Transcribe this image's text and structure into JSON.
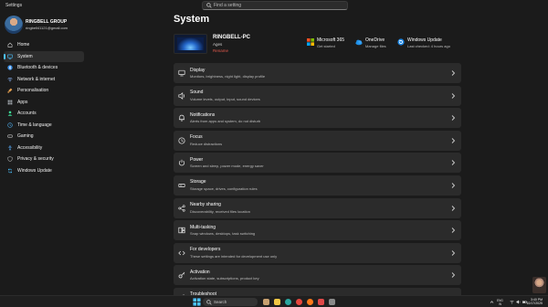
{
  "app": {
    "title": "Settings"
  },
  "search": {
    "placeholder": "Find a setting"
  },
  "profile": {
    "name": "RINGBELL GROUP",
    "email": "ringbell41121@gmail.com"
  },
  "sidebar": {
    "items": [
      {
        "label": "Home",
        "icon": "home-icon",
        "color": "#d9d9d9",
        "active": false
      },
      {
        "label": "System",
        "icon": "monitor-icon",
        "color": "#4cc2ff",
        "active": true
      },
      {
        "label": "Bluetooth & devices",
        "icon": "bluetooth-icon",
        "color": "#3a8ee6",
        "active": false
      },
      {
        "label": "Network & internet",
        "icon": "network-icon",
        "color": "#8ab4f8",
        "active": false
      },
      {
        "label": "Personalisation",
        "icon": "brush-icon",
        "color": "#e6a050",
        "active": false
      },
      {
        "label": "Apps",
        "icon": "apps-icon",
        "color": "#9aa0a6",
        "active": false
      },
      {
        "label": "Accounts",
        "icon": "person-icon",
        "color": "#3ddc97",
        "active": false
      },
      {
        "label": "Time & language",
        "icon": "globe-clock-icon",
        "color": "#4aa3df",
        "active": false
      },
      {
        "label": "Gaming",
        "icon": "gamepad-icon",
        "color": "#b0b0b0",
        "active": false
      },
      {
        "label": "Accessibility",
        "icon": "accessibility-icon",
        "color": "#5ab0ff",
        "active": false
      },
      {
        "label": "Privacy & security",
        "icon": "shield-icon",
        "color": "#a0a0a0",
        "active": false
      },
      {
        "label": "Windows Update",
        "icon": "sync-icon",
        "color": "#4cc2ff",
        "active": false
      }
    ]
  },
  "main": {
    "title": "System",
    "device": {
      "name": "RINGBELL-PC",
      "model": "Ages",
      "rename": "Rename"
    },
    "top_links": [
      {
        "title": "Microsoft 365",
        "subtitle": "Get started",
        "icon": "microsoft-365-icon"
      },
      {
        "title": "OneDrive",
        "subtitle": "Manage files",
        "icon": "onedrive-icon"
      },
      {
        "title": "Windows Update",
        "subtitle": "Last checked: 4 hours ago",
        "icon": "windows-update-icon"
      }
    ],
    "cards": [
      {
        "title": "Display",
        "subtitle": "Monitors, brightness, night light, display profile",
        "icon": "display-icon"
      },
      {
        "title": "Sound",
        "subtitle": "Volume levels, output, input, sound devices",
        "icon": "speaker-icon"
      },
      {
        "title": "Notifications",
        "subtitle": "Alerts from apps and system, do not disturb",
        "icon": "bell-icon"
      },
      {
        "title": "Focus",
        "subtitle": "Reduce distractions",
        "icon": "focus-icon"
      },
      {
        "title": "Power",
        "subtitle": "Screen and sleep, power mode, energy saver",
        "icon": "power-icon"
      },
      {
        "title": "Storage",
        "subtitle": "Storage space, drives, configuration rules",
        "icon": "storage-icon"
      },
      {
        "title": "Nearby sharing",
        "subtitle": "Discoverability, received files location",
        "icon": "share-icon"
      },
      {
        "title": "Multi-tasking",
        "subtitle": "Snap windows, desktops, task switching",
        "icon": "multitask-icon"
      },
      {
        "title": "For developers",
        "subtitle": "These settings are intended for development use only",
        "icon": "developer-icon"
      },
      {
        "title": "Activation",
        "subtitle": "Activation state, subscriptions, product key",
        "icon": "key-icon"
      },
      {
        "title": "Troubleshoot",
        "subtitle": "",
        "icon": "wrench-icon"
      }
    ]
  },
  "taskbar": {
    "search_label": "Search",
    "apps": [
      {
        "icon": "cat-app-icon",
        "color": "#c8a070"
      },
      {
        "icon": "file-explorer-icon",
        "color": "#f2c744"
      },
      {
        "icon": "edge-icon",
        "color": "#2aa7a0"
      },
      {
        "icon": "chrome-icon",
        "color": "#e8473e"
      },
      {
        "icon": "firefox-icon",
        "color": "#ff7a1a"
      },
      {
        "icon": "app-icon",
        "color": "#e04848"
      },
      {
        "icon": "settings-gear-icon",
        "color": "#8a8a8a"
      }
    ],
    "tray_lang": "ENG",
    "tray_lang2": "IN",
    "clock_time": "3:40 PM",
    "clock_date": "10/17/2025"
  },
  "colors": {
    "accent": "#4cc2ff",
    "rename": "#e0584c",
    "card_bg": "#2b2b2b",
    "window_bg": "#1b1b1b"
  }
}
